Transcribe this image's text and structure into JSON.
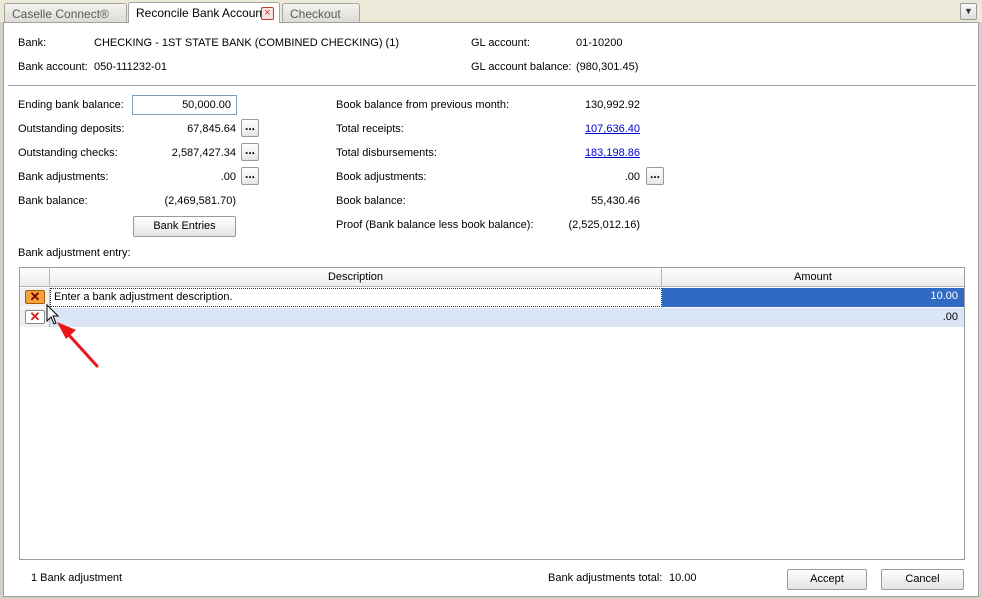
{
  "tabs": [
    {
      "label": "Caselle Connect®"
    },
    {
      "label": "Reconcile Bank Accounts",
      "close": "×"
    },
    {
      "label": "Checkout"
    }
  ],
  "tab_menu_glyph": "▼",
  "header": {
    "bank_label": "Bank:",
    "bank_value": "CHECKING - 1ST STATE BANK (COMBINED CHECKING) (1)",
    "bank_account_label": "Bank account:",
    "bank_account_value": "050-111232-01",
    "gl_account_label": "GL account:",
    "gl_account_value": "01-10200",
    "gl_balance_label": "GL account balance:",
    "gl_balance_value": "(980,301.45)"
  },
  "bank_side": {
    "ending_label": "Ending bank balance:",
    "ending_value": "50,000.00",
    "deposits_label": "Outstanding deposits:",
    "deposits_value": "67,845.64",
    "checks_label": "Outstanding checks:",
    "checks_value": "2,587,427.34",
    "adjustments_label": "Bank adjustments:",
    "adjustments_value": ".00",
    "balance_label": "Bank balance:",
    "balance_value": "(2,469,581.70)",
    "entries_button": "Bank Entries",
    "dots": "..."
  },
  "book_side": {
    "prev_label": "Book balance from previous month:",
    "prev_value": "130,992.92",
    "receipts_label": "Total receipts:",
    "receipts_value": "107,636.40",
    "disb_label": "Total disbursements:",
    "disb_value": "183,198.86",
    "adjustments_label": "Book adjustments:",
    "adjustments_value": ".00",
    "balance_label": "Book balance:",
    "balance_value": "55,430.46",
    "proof_label": "Proof (Bank balance less book balance):",
    "proof_value": "(2,525,012.16)"
  },
  "grid": {
    "title": "Bank adjustment entry:",
    "col_description": "Description",
    "col_amount": "Amount",
    "delete_glyph": "✕",
    "rows": [
      {
        "description": "Enter a bank adjustment description.",
        "amount": "10.00"
      },
      {
        "description": "",
        "amount": ".00"
      }
    ]
  },
  "footer": {
    "count": "1 Bank adjustment",
    "total_label": "Bank adjustments total:",
    "total_value": "10.00",
    "accept": "Accept",
    "cancel": "Cancel"
  }
}
